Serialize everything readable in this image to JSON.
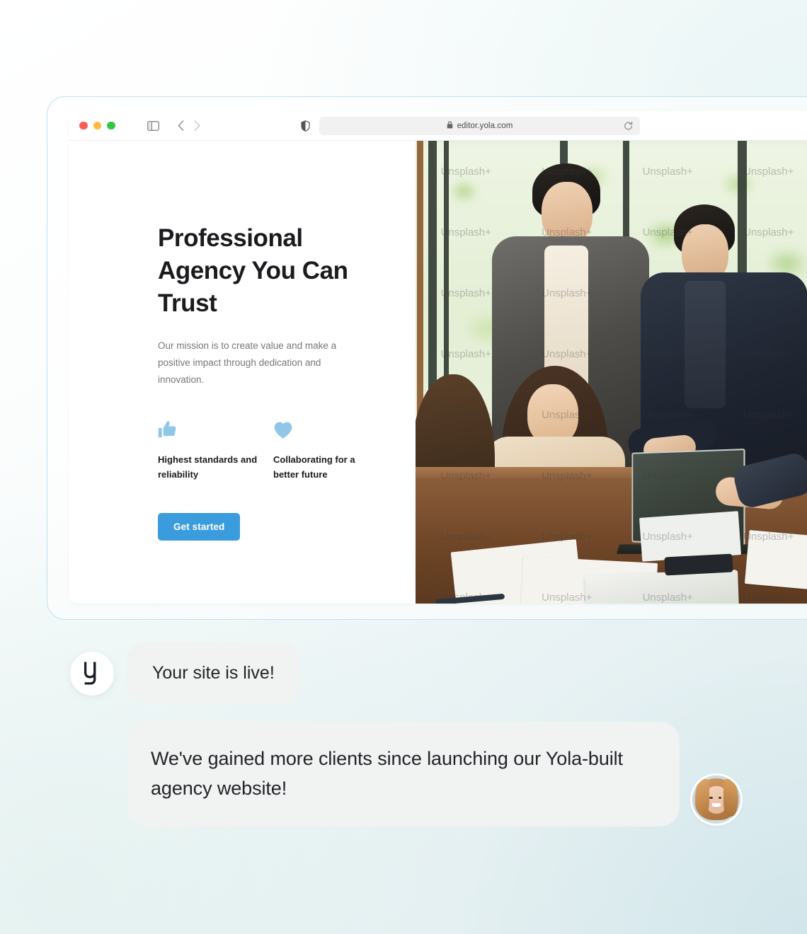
{
  "browser": {
    "traffic_lights": [
      "close",
      "minimize",
      "maximize"
    ],
    "sidebar_toggle_label": "sidebar-toggle",
    "back_label": "back",
    "forward_label": "forward",
    "shield_label": "privacy-shield",
    "url": "editor.yola.com",
    "lock_label": "secure",
    "reload_label": "reload"
  },
  "site": {
    "hero": {
      "title": "Professional Agency You Can Trust",
      "subtitle": "Our mission is to create value and make a positive impact through dedication and innovation.",
      "features": [
        {
          "icon": "thumbs-up-icon",
          "label": "Highest standards and reliability"
        },
        {
          "icon": "heart-icon",
          "label": "Collaborating for a better future"
        }
      ],
      "cta_label": "Get started"
    },
    "photo": {
      "alt": "Business team collaborating around a table with laptop and documents",
      "watermark": "Unsplash+"
    }
  },
  "chat": {
    "messages": [
      {
        "avatar": "yola-logo",
        "avatar_glyph": "y",
        "text": "Your site is live!"
      },
      {
        "avatar": "client-photo",
        "text": "We've gained more clients since launching our Yola-built agency website!"
      }
    ]
  },
  "colors": {
    "accent_blue": "#3a9cdc",
    "icon_blue": "#90c7e9",
    "bubble_grey": "#f1f2f2",
    "text_dark": "#1b1b1f",
    "text_muted": "#75777b",
    "frame_border": "#bfe0ef"
  }
}
